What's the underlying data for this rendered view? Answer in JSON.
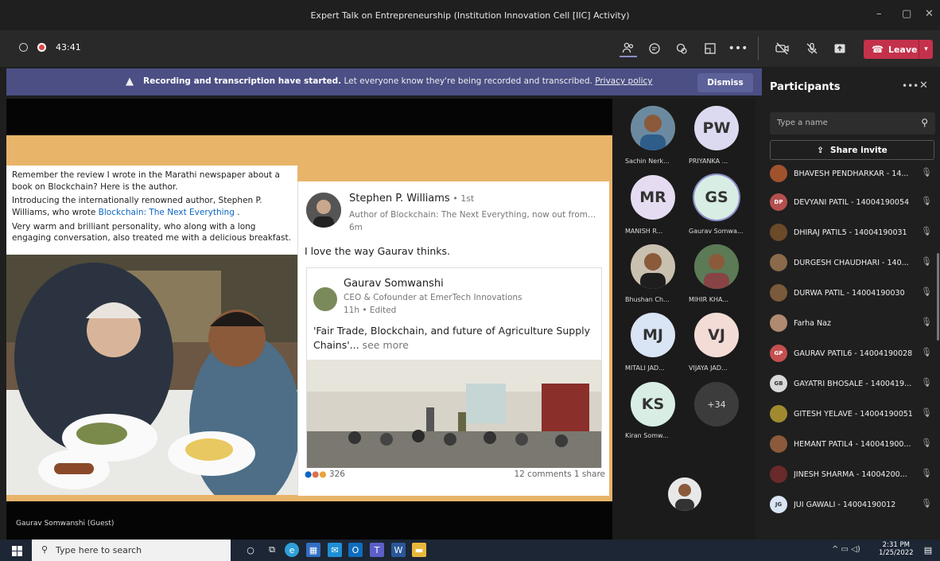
{
  "window": {
    "title": "Expert Talk on Entrepreneurship (Institution Innovation Cell [IIC] Activity)",
    "min": "–",
    "max": "▢",
    "close": "✕"
  },
  "toolbar": {
    "timer": "43:41",
    "leave_label": "Leave",
    "more": "•••"
  },
  "banner": {
    "bold": "Recording and transcription have started.",
    "text": " Let everyone know they're being recorded and transcribed. ",
    "link": "Privacy policy",
    "dismiss": "Dismiss"
  },
  "post": {
    "line1": "Remember the review I wrote in the Marathi newspaper about a book on Blockchain? Here is the author.",
    "line2a": "Introducing the internationally renowned author, Stephen P. Williams, who wrote ",
    "line2link": "Blockchain: The Next Everything",
    "line2b": " .",
    "line3": "Very warm and brilliant personality, who along with a long engaging conversation, also treated me with a delicious breakfast."
  },
  "card": {
    "name": "Stephen P. Williams",
    "degree": " • 1st",
    "subtitle": "Author of Blockchain: The Next Everything, now out from...",
    "time": "6m",
    "quote": "I love the way Gaurav thinks.",
    "inner_name": "Gaurav Somwanshi",
    "inner_sub": "CEO & Cofounder at EmerTech Innovations",
    "inner_time": "11h • Edited",
    "inner_quote": "'Fair Trade, Blockchain, and future of Agriculture Supply Chains'...",
    "see_more": " see more",
    "reactions": "326",
    "comments": "12 comments 1 share"
  },
  "stage_label": "Gaurav Somwanshi (Guest)",
  "gallery": [
    {
      "initials": "",
      "name": "Sachin Nerk..."
    },
    {
      "initials": "PW",
      "name": "PRIYANKA ..."
    },
    {
      "initials": "MR",
      "name": "MANISH R..."
    },
    {
      "initials": "GS",
      "name": "Gaurav Somwa..."
    },
    {
      "initials": "",
      "name": "Bhushan Ch..."
    },
    {
      "initials": "",
      "name": "MIHIR KHA..."
    },
    {
      "initials": "MJ",
      "name": "MITALI JAD..."
    },
    {
      "initials": "VJ",
      "name": "VIJAYA JAD..."
    },
    {
      "initials": "KS",
      "name": "Kiran Somw..."
    },
    {
      "initials": "+34",
      "name": ""
    }
  ],
  "panel": {
    "title": "Participants",
    "search_placeholder": "Type a name",
    "share_invite": "Share invite",
    "people": [
      {
        "initials": "",
        "name": "BHAVESH PENDHARKAR - 14..."
      },
      {
        "initials": "DP",
        "name": "DEVYANI PATIL - 14004190054"
      },
      {
        "initials": "",
        "name": "DHIRAJ PATIL5 - 14004190031"
      },
      {
        "initials": "",
        "name": "DURGESH CHAUDHARI - 140..."
      },
      {
        "initials": "",
        "name": "DURWA PATIL - 14004190030"
      },
      {
        "initials": "",
        "name": "Farha Naz"
      },
      {
        "initials": "GP",
        "name": "GAURAV PATIL6 - 14004190028"
      },
      {
        "initials": "GB",
        "name": "GAYATRI BHOSALE - 1400419..."
      },
      {
        "initials": "",
        "name": "GITESH YELAVE - 14004190051"
      },
      {
        "initials": "",
        "name": "HEMANT PATIL4 - 140041900..."
      },
      {
        "initials": "",
        "name": "JINESH SHARMA - 14004200..."
      },
      {
        "initials": "JG",
        "name": "JUI GAWALI - 14004190012"
      }
    ]
  },
  "taskbar": {
    "search_placeholder": "Type here to search",
    "time": "2:31 PM",
    "date": "1/25/2022"
  },
  "colors": {
    "accent": "#6264a7",
    "leave": "#c4314b",
    "banner": "#4b4f84"
  }
}
